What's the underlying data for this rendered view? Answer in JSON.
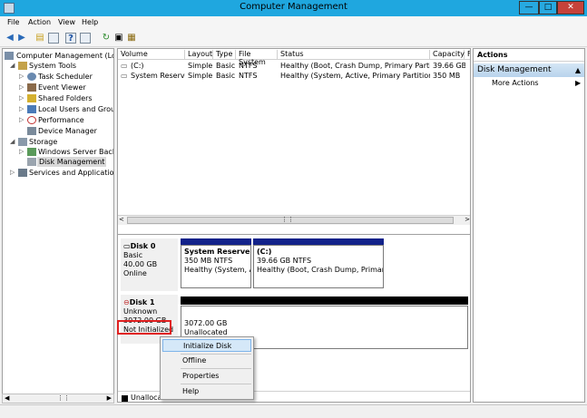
{
  "window": {
    "title": "Computer Management",
    "minimize": "—",
    "maximize": "□",
    "close": "✕"
  },
  "menu": [
    "File",
    "Action",
    "View",
    "Help"
  ],
  "toolbar": {
    "icons": [
      "back-arrow-icon",
      "forward-arrow-icon",
      "up-folder-icon",
      "show-hide-tree-icon",
      "help-icon",
      "properties-icon",
      "refresh-icon",
      "export-icon",
      "settings-icon"
    ]
  },
  "tree": {
    "root": "Computer Management (Local",
    "system_tools": "System Tools",
    "task_scheduler": "Task Scheduler",
    "event_viewer": "Event Viewer",
    "shared_folders": "Shared Folders",
    "local_users": "Local Users and Groups",
    "performance": "Performance",
    "device_manager": "Device Manager",
    "storage": "Storage",
    "wsb": "Windows Server Backup",
    "disk_mgmt": "Disk Management",
    "services": "Services and Applications"
  },
  "volumes": {
    "headers": [
      "Volume",
      "Layout",
      "Type",
      "File System",
      "Status",
      "Capacity",
      "F"
    ],
    "rows": [
      [
        "(C:)",
        "Simple",
        "Basic",
        "NTFS",
        "Healthy (Boot, Crash Dump, Primary Partition)",
        "39.66 GB"
      ],
      [
        "System Reserved",
        "Simple",
        "Basic",
        "NTFS",
        "Healthy (System, Active, Primary Partition)",
        "350 MB"
      ]
    ]
  },
  "disk0": {
    "name": "Disk 0",
    "type": "Basic",
    "size": "40.00 GB",
    "state": "Online",
    "partitions": [
      {
        "title": "System Reserved",
        "size": "350 MB NTFS",
        "status": "Healthy (System, Ac"
      },
      {
        "title": "(C:)",
        "size": "39.66 GB NTFS",
        "status": "Healthy (Boot, Crash Dump, Primary Pa"
      }
    ]
  },
  "disk1": {
    "name": "Disk 1",
    "type": "Unknown",
    "size": "3072.00 GB",
    "state": "Not Initialized",
    "partition": {
      "size": "3072.00 GB",
      "status": "Unallocated"
    }
  },
  "legend": {
    "unallocated": "Unalloca"
  },
  "context_menu": [
    "Initialize Disk",
    "Offline",
    "Properties",
    "Help"
  ],
  "actions": {
    "title": "Actions",
    "section": "Disk Management",
    "more": "More Actions"
  },
  "colors": {
    "titlebar": "#1fa7df",
    "primary_partition": "#12228a",
    "highlight": "#e02020"
  }
}
